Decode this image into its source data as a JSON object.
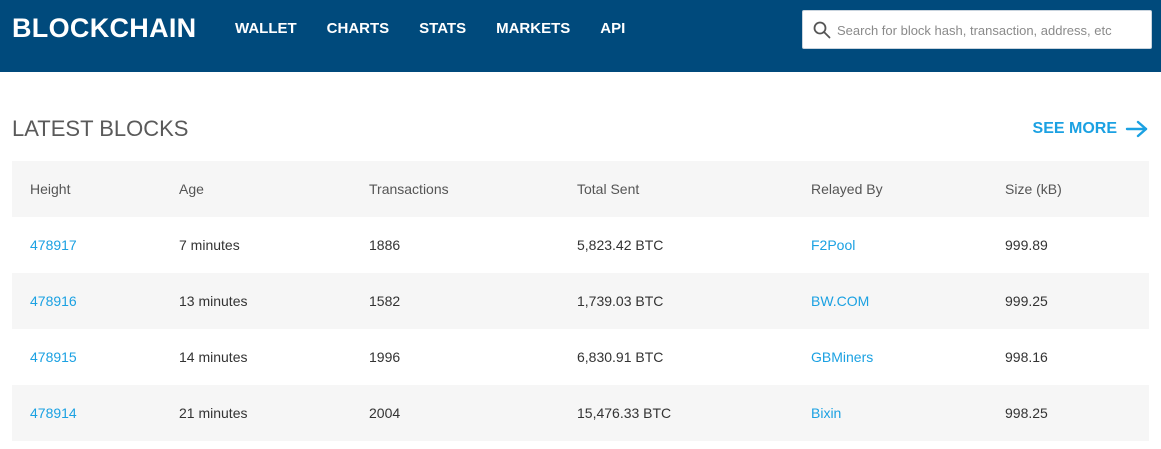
{
  "header": {
    "logo": "BLOCKCHAIN",
    "nav": [
      "WALLET",
      "CHARTS",
      "STATS",
      "MARKETS",
      "API"
    ],
    "search_placeholder": "Search for block hash, transaction, address, etc"
  },
  "section": {
    "title": "LATEST BLOCKS",
    "see_more": "SEE MORE"
  },
  "table": {
    "columns": [
      "Height",
      "Age",
      "Transactions",
      "Total Sent",
      "Relayed By",
      "Size (kB)"
    ],
    "rows": [
      {
        "height": "478917",
        "age": "7 minutes",
        "transactions": "1886",
        "total_sent": "5,823.42 BTC",
        "relayed_by": "F2Pool",
        "size": "999.89"
      },
      {
        "height": "478916",
        "age": "13 minutes",
        "transactions": "1582",
        "total_sent": "1,739.03 BTC",
        "relayed_by": "BW.COM",
        "size": "999.25"
      },
      {
        "height": "478915",
        "age": "14 minutes",
        "transactions": "1996",
        "total_sent": "6,830.91 BTC",
        "relayed_by": "GBMiners",
        "size": "998.16"
      },
      {
        "height": "478914",
        "age": "21 minutes",
        "transactions": "2004",
        "total_sent": "15,476.33 BTC",
        "relayed_by": "Bixin",
        "size": "998.25"
      }
    ]
  },
  "colors": {
    "brand": "#004a7c",
    "link": "#1ba1e2"
  }
}
